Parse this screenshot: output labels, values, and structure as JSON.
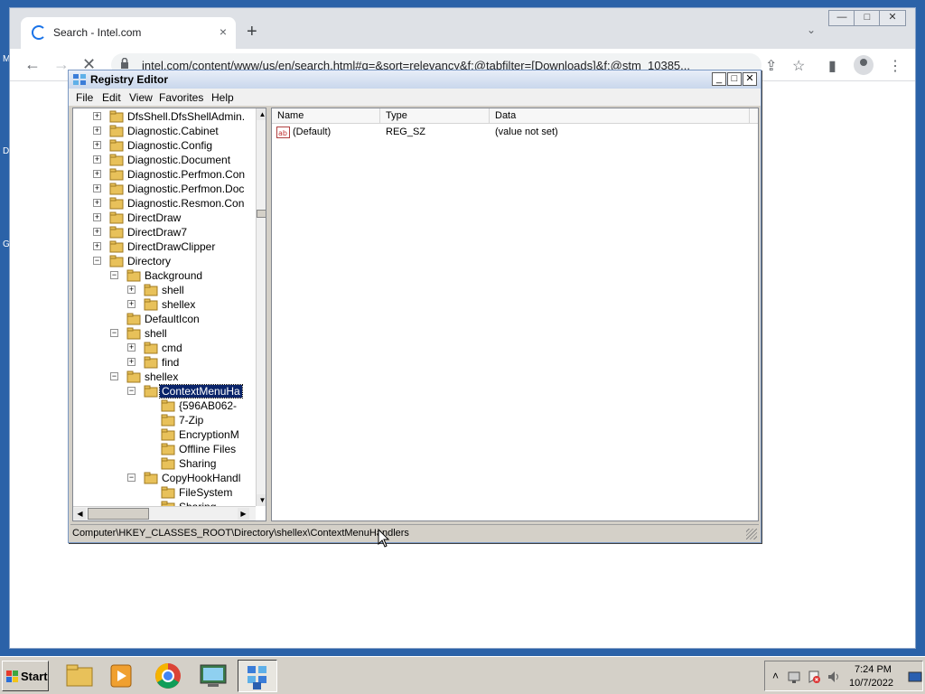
{
  "chrome": {
    "tab_title": "Search - Intel.com",
    "tab_close": "×",
    "new_tab": "+",
    "tab_search": "⌄",
    "url": "intel.com/content/www/us/en/search.html#q=&sort=relevancy&f:@tabfilter=[Downloads]&f:@stm_10385...",
    "back": "←",
    "forward": "→",
    "stop": "✕",
    "share": "⇪",
    "bookmark": "☆",
    "side_panel": "▮",
    "menu": "⋮",
    "win_min": "—",
    "win_max": "□",
    "win_close": "✕"
  },
  "desktop_frags": [
    "M",
    "D",
    "G"
  ],
  "regedit": {
    "title": "Registry Editor",
    "controls": {
      "min": "_",
      "max": "□",
      "close": "✕"
    },
    "menu": [
      "File",
      "Edit",
      "View",
      "Favorites",
      "Help"
    ],
    "tree": [
      {
        "label": "DfsShell.DfsShellAdmin.",
        "level": 0,
        "exp": "+"
      },
      {
        "label": "Diagnostic.Cabinet",
        "level": 0,
        "exp": "+"
      },
      {
        "label": "Diagnostic.Config",
        "level": 0,
        "exp": "+"
      },
      {
        "label": "Diagnostic.Document",
        "level": 0,
        "exp": "+"
      },
      {
        "label": "Diagnostic.Perfmon.Con",
        "level": 0,
        "exp": "+"
      },
      {
        "label": "Diagnostic.Perfmon.Doc",
        "level": 0,
        "exp": "+"
      },
      {
        "label": "Diagnostic.Resmon.Con",
        "level": 0,
        "exp": "+"
      },
      {
        "label": "DirectDraw",
        "level": 0,
        "exp": "+"
      },
      {
        "label": "DirectDraw7",
        "level": 0,
        "exp": "+"
      },
      {
        "label": "DirectDrawClipper",
        "level": 0,
        "exp": "+"
      },
      {
        "label": "Directory",
        "level": 0,
        "exp": "−"
      },
      {
        "label": "Background",
        "level": 1,
        "exp": "−"
      },
      {
        "label": "shell",
        "level": 2,
        "exp": "+"
      },
      {
        "label": "shellex",
        "level": 2,
        "exp": "+"
      },
      {
        "label": "DefaultIcon",
        "level": 1,
        "exp": ""
      },
      {
        "label": "shell",
        "level": 1,
        "exp": "−"
      },
      {
        "label": "cmd",
        "level": 2,
        "exp": "+"
      },
      {
        "label": "find",
        "level": 2,
        "exp": "+"
      },
      {
        "label": "shellex",
        "level": 1,
        "exp": "−"
      },
      {
        "label": "ContextMenuHa",
        "level": 2,
        "exp": "−",
        "selected": true
      },
      {
        "label": "{596AB062-",
        "level": 3,
        "exp": ""
      },
      {
        "label": "7-Zip",
        "level": 3,
        "exp": ""
      },
      {
        "label": "EncryptionM",
        "level": 3,
        "exp": ""
      },
      {
        "label": "Offline Files",
        "level": 3,
        "exp": ""
      },
      {
        "label": "Sharing",
        "level": 3,
        "exp": ""
      },
      {
        "label": "CopyHookHandl",
        "level": 2,
        "exp": "−"
      },
      {
        "label": "FileSystem",
        "level": 3,
        "exp": ""
      },
      {
        "label": "Sharing",
        "level": 3,
        "exp": ""
      }
    ],
    "columns": [
      "Name",
      "Type",
      "Data"
    ],
    "values": [
      {
        "name": "(Default)",
        "type": "REG_SZ",
        "data": "(value not set)",
        "icon": "ab"
      }
    ],
    "status_path": "Computer\\HKEY_CLASSES_ROOT\\Directory\\shellex\\ContextMenuHandlers"
  },
  "taskbar": {
    "start_label": "Start",
    "apps": [
      "file-explorer",
      "media-player",
      "chrome",
      "remote-desktop",
      "registry-editor"
    ],
    "tray_expand": "˄",
    "clock_time": "7:24 PM",
    "clock_date": "10/7/2022"
  },
  "colors": {
    "desktop": "#2b62a8",
    "selection": "#0a246a",
    "chrome_accent": "#1a73e8",
    "folder": "#e8c15a"
  }
}
